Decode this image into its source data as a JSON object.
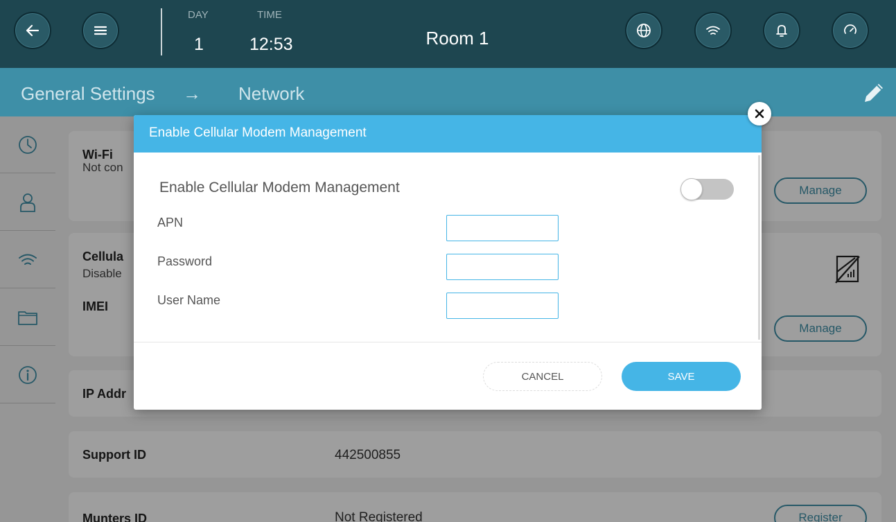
{
  "header": {
    "day_label": "DAY",
    "day_value": "1",
    "time_label": "TIME",
    "time_value": "12:53",
    "room_title": "Room 1",
    "icons": [
      "back-arrow-icon",
      "menu-icon",
      "globe-icon",
      "wifi-icon",
      "bell-icon",
      "gauge-icon"
    ]
  },
  "breadcrumb": {
    "parent": "General Settings",
    "separator": "→",
    "current": "Network"
  },
  "sidebar": {
    "items": [
      "clock-icon",
      "user-icon",
      "wifi-icon",
      "folder-icon",
      "info-icon"
    ]
  },
  "cards": {
    "wifi": {
      "title": "Wi-Fi",
      "status": "Not con",
      "button": "Manage"
    },
    "cellular": {
      "title": "Cellula",
      "status": "Disable",
      "imei_label": "IMEI",
      "button": "Manage"
    },
    "ip": {
      "title": "IP Addr"
    },
    "support": {
      "title": "Support ID",
      "value": "442500855"
    },
    "munters": {
      "title": "Munters ID",
      "value": "Not Registered",
      "button": "Register"
    }
  },
  "modal": {
    "title": "Enable Cellular Modem Management",
    "toggle_label": "Enable Cellular Modem Management",
    "toggle_on": false,
    "fields": [
      {
        "label": "APN",
        "value": ""
      },
      {
        "label": "Password",
        "value": ""
      },
      {
        "label": "User Name",
        "value": ""
      }
    ],
    "cancel_label": "CANCEL",
    "save_label": "SAVE"
  },
  "colors": {
    "topbar": "#1e4650",
    "breadcrumb_bar": "#3e8fa7",
    "modal_accent": "#45b5e6"
  }
}
